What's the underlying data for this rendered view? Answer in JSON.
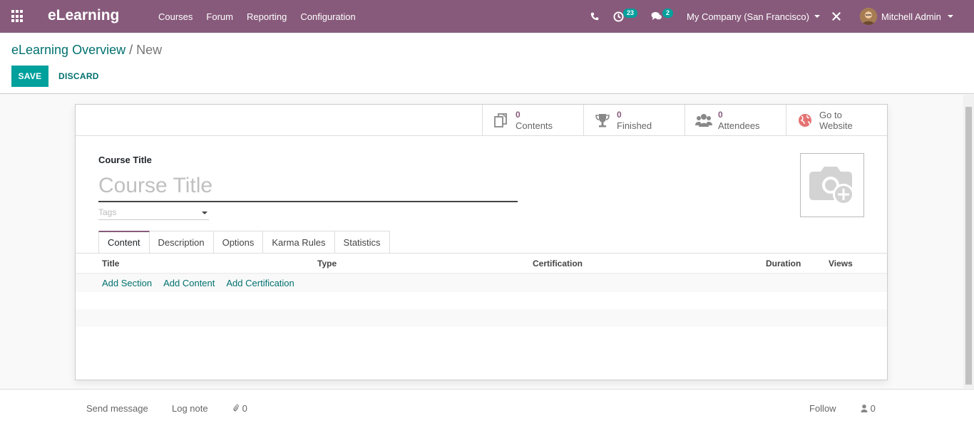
{
  "navbar": {
    "brand": "eLearning",
    "menu": [
      "Courses",
      "Forum",
      "Reporting",
      "Configuration"
    ],
    "activity_count": "23",
    "message_count": "2",
    "company": "My Company (San Francisco)",
    "user": "Mitchell Admin"
  },
  "breadcrumb": {
    "parent": "eLearning Overview",
    "separator": "/",
    "current": "New"
  },
  "buttons": {
    "save": "SAVE",
    "discard": "DISCARD"
  },
  "stats": [
    {
      "value": "0",
      "label": "Contents",
      "icon": "files-icon"
    },
    {
      "value": "0",
      "label": "Finished",
      "icon": "trophy-icon"
    },
    {
      "value": "0",
      "label": "Attendees",
      "icon": "users-icon"
    },
    {
      "value": "Go to",
      "label": "Website",
      "icon": "globe-icon"
    }
  ],
  "form": {
    "course_label": "Course Title",
    "course_placeholder": "Course Title",
    "tags_placeholder": "Tags"
  },
  "tabs": [
    "Content",
    "Description",
    "Options",
    "Karma Rules",
    "Statistics"
  ],
  "table": {
    "headers": [
      "Title",
      "Type",
      "Certification",
      "Duration",
      "Views"
    ],
    "add_links": [
      "Add Section",
      "Add Content",
      "Add Certification"
    ]
  },
  "chatter": {
    "send_message": "Send message",
    "log_note": "Log note",
    "attachments": "0",
    "follow": "Follow",
    "followers": "0"
  },
  "colors": {
    "brand": "#875a7b",
    "accent": "#00a09d",
    "link": "#00716f"
  }
}
